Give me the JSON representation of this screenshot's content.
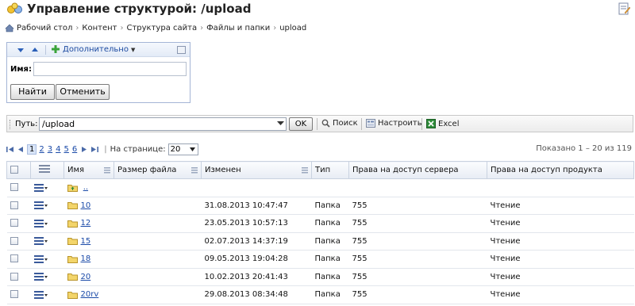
{
  "header": {
    "title": "Управление структурой: /upload"
  },
  "breadcrumb": [
    "Рабочий стол",
    "Контент",
    "Структура сайта",
    "Файлы и папки",
    "upload"
  ],
  "filter": {
    "more_label": "Дополнительно",
    "name_label": "Имя:",
    "name_value": "",
    "find_label": "Найти",
    "cancel_label": "Отменить"
  },
  "pathbar": {
    "label": "Путь:",
    "value": "/upload",
    "ok_label": "OK",
    "search_label": "Поиск",
    "settings_label": "Настроить",
    "excel_label": "Excel"
  },
  "pager": {
    "pages": [
      "1",
      "2",
      "3",
      "4",
      "5",
      "6"
    ],
    "current": "1",
    "per_page_label": "На странице:",
    "per_page_value": "20",
    "shown": "Показано 1 – 20 из 119"
  },
  "grid": {
    "columns": [
      "Имя",
      "Размер файла",
      "Изменен",
      "Тип",
      "Права на доступ сервера",
      "Права на доступ продукта"
    ],
    "up_label": "..",
    "rows": [
      {
        "name": "10",
        "size": "",
        "modified": "31.08.2013 10:47:47",
        "type": "Папка",
        "server_rights": "755",
        "product_rights": "Чтение"
      },
      {
        "name": "12",
        "size": "",
        "modified": "23.05.2013 10:57:13",
        "type": "Папка",
        "server_rights": "755",
        "product_rights": "Чтение"
      },
      {
        "name": "15",
        "size": "",
        "modified": "02.07.2013 14:37:19",
        "type": "Папка",
        "server_rights": "755",
        "product_rights": "Чтение"
      },
      {
        "name": "18",
        "size": "",
        "modified": "09.05.2013 19:04:28",
        "type": "Папка",
        "server_rights": "755",
        "product_rights": "Чтение"
      },
      {
        "name": "20",
        "size": "",
        "modified": "10.02.2013 20:41:43",
        "type": "Папка",
        "server_rights": "755",
        "product_rights": "Чтение"
      },
      {
        "name": "20rv",
        "size": "",
        "modified": "29.08.2013 08:34:48",
        "type": "Папка",
        "server_rights": "755",
        "product_rights": "Чтение"
      }
    ]
  },
  "colors": {
    "link": "#1a4aa8",
    "folder": "#f3d56a",
    "accent": "#2a5fb8"
  }
}
